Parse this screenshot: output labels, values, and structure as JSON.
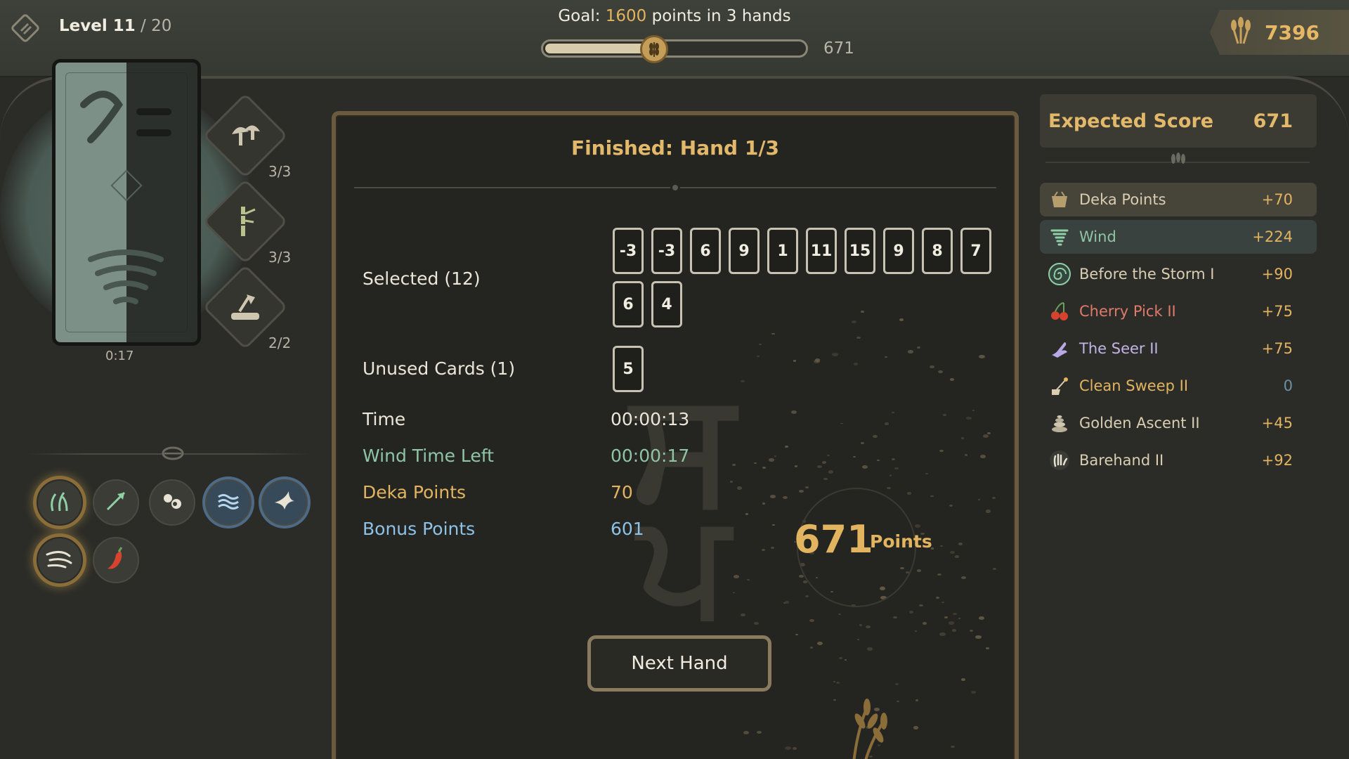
{
  "header": {
    "level_label": "Level 11",
    "level_sep": " / ",
    "level_max": "20",
    "goal_prefix": "Goal: ",
    "goal_points": "1600",
    "goal_suffix": " points in 3 hands",
    "progress_value": "671",
    "progress_fraction": 0.42,
    "currency_value": "7396"
  },
  "deck": {
    "timer": "0:17",
    "slots": [
      {
        "icon": "mushroom-icon",
        "count": "3/3"
      },
      {
        "icon": "bamboo-icon",
        "count": "3/3"
      },
      {
        "icon": "axe-stump-icon",
        "count": "2/2"
      }
    ]
  },
  "abilities": [
    {
      "icon": "wind-grass-icon",
      "style": "gold"
    },
    {
      "icon": "arrow-icon",
      "style": "plain"
    },
    {
      "icon": "stones-icon",
      "style": "plain"
    },
    {
      "icon": "waves-icon",
      "style": "blue"
    },
    {
      "icon": "swallow-icon",
      "style": "blue"
    },
    {
      "icon": "gust-icon",
      "style": "gold"
    },
    {
      "icon": "chili-icon",
      "style": "plain"
    }
  ],
  "summary": {
    "title": "Finished: Hand 1/3",
    "selected_label": "Selected (12)",
    "selected_cards": [
      "-3",
      "-3",
      "6",
      "9",
      "1",
      "11",
      "15",
      "9",
      "8",
      "7",
      "6",
      "4"
    ],
    "unused_label": "Unused Cards (1)",
    "unused_cards": [
      "5"
    ],
    "time_label": "Time",
    "time_value": "00:00:13",
    "wind_label": "Wind Time Left",
    "wind_value": "00:00:17",
    "deka_label": "Deka Points",
    "deka_value": "70",
    "bonus_label": "Bonus Points",
    "bonus_value": "601",
    "total_points": "671",
    "points_word": "Points",
    "next_button": "Next Hand"
  },
  "expected": {
    "title": "Expected Score",
    "value": "671",
    "items": [
      {
        "name": "Deka Points",
        "value": "+70",
        "icon": "basket-icon",
        "color": "#d9cdb2",
        "hl": "hl1"
      },
      {
        "name": "Wind",
        "value": "+224",
        "icon": "tornado-icon",
        "color": "#8fc4a4",
        "hl": "hl2"
      },
      {
        "name": "Before the Storm I",
        "value": "+90",
        "icon": "spiral-icon",
        "color": "#d9cdb2",
        "hl": ""
      },
      {
        "name": "Cherry Pick II",
        "value": "+75",
        "icon": "cherry-icon",
        "color": "#e07a6a",
        "hl": ""
      },
      {
        "name": "The Seer II",
        "value": "+75",
        "icon": "seer-hand-icon",
        "color": "#c2b5e6",
        "hl": ""
      },
      {
        "name": "Clean Sweep II",
        "value": "0",
        "icon": "broom-icon",
        "color": "#e2b45f",
        "hl": ""
      },
      {
        "name": "Golden Ascent II",
        "value": "+45",
        "icon": "stacked-stones-icon",
        "color": "#d9cdb2",
        "hl": ""
      },
      {
        "name": "Barehand II",
        "value": "+92",
        "icon": "open-hand-icon",
        "color": "#d9cdb2",
        "hl": ""
      }
    ]
  }
}
